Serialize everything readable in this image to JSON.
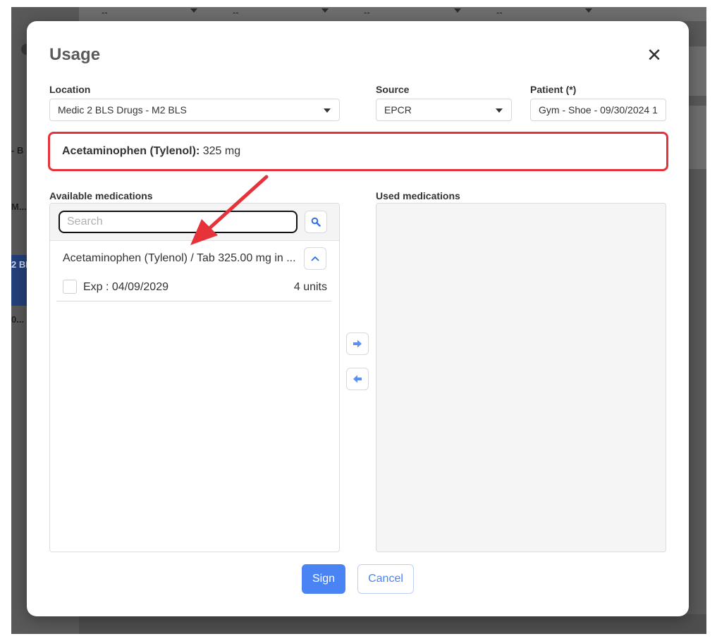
{
  "modal": {
    "title": "Usage",
    "close_icon": "close-icon"
  },
  "form": {
    "location": {
      "label": "Location",
      "value": "Medic 2 BLS Drugs - M2 BLS"
    },
    "source": {
      "label": "Source",
      "value": "EPCR"
    },
    "patient": {
      "label": "Patient (*)",
      "value": "Gym - Shoe - 09/30/2024 1"
    }
  },
  "summary": {
    "medication": "Acetaminophen (Tylenol):",
    "dose": "325 mg",
    "highlight_color": "#e5323b"
  },
  "available": {
    "label": "Available medications",
    "search_placeholder": "Search",
    "search_icon": "search-icon",
    "group": {
      "name": "Acetaminophen (Tylenol) / Tab 325.00 mg in ...",
      "toggle_icon": "chevron-up-icon"
    },
    "lots": [
      {
        "exp": "Exp : 04/09/2029",
        "units": "4 units"
      }
    ]
  },
  "used": {
    "label": "Used medications"
  },
  "transfer": {
    "right_icon": "arrow-right-icon",
    "left_icon": "arrow-left-icon"
  },
  "actions": {
    "sign_label": "Sign",
    "cancel_label": "Cancel",
    "accent_color": "#4a84f4"
  },
  "background": {
    "fragments": [
      "- B",
      "M...",
      "2 BL",
      "0..."
    ],
    "top_fields": [
      "--",
      "--",
      "--",
      "--"
    ]
  },
  "annotation": {
    "arrow_color": "#e5323b",
    "arrow_icon": "annotation-arrow-icon"
  }
}
